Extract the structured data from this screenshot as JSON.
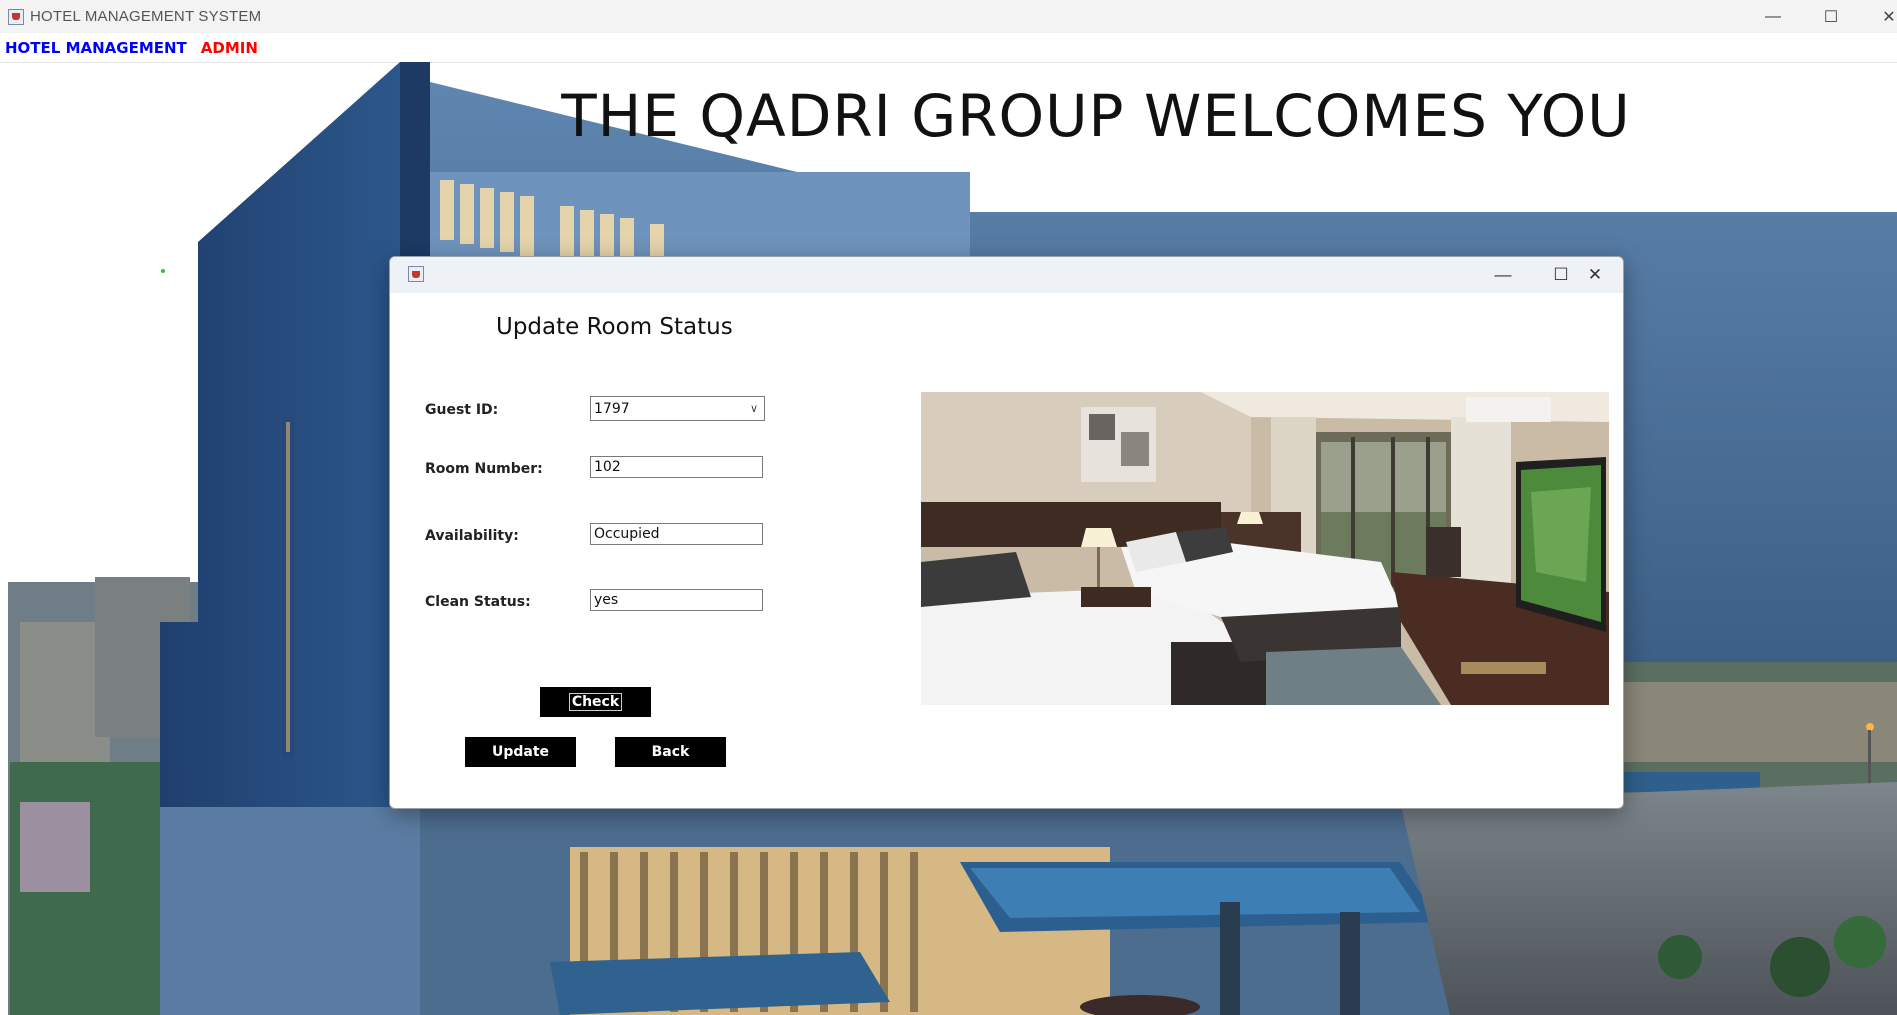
{
  "window": {
    "title": "HOTEL MANAGEMENT SYSTEM",
    "minimize": "—",
    "maximize": "☐",
    "close": "✕"
  },
  "menu": {
    "items": [
      "HOTEL MANAGEMENT",
      "ADMIN"
    ],
    "colors": [
      "#0000ff",
      "#ff0000"
    ]
  },
  "background": {
    "welcome_text": "THE QADRI GROUP WELCOMES YOU"
  },
  "dialog": {
    "minimize": "—",
    "maximize": "☐",
    "close": "✕",
    "heading": "Update Room Status",
    "guest_id_label": "Guest ID:",
    "guest_id_value": "1797",
    "room_number_label": "Room Number:",
    "room_number_value": "102",
    "availability_label": "Availability:",
    "availability_value": "Occupied",
    "clean_status_label": "Clean Status:",
    "clean_status_value": "yes",
    "check_button": "Check",
    "update_button": "Update",
    "back_button": "Back",
    "photo_icon": "hotel-room-photo"
  }
}
